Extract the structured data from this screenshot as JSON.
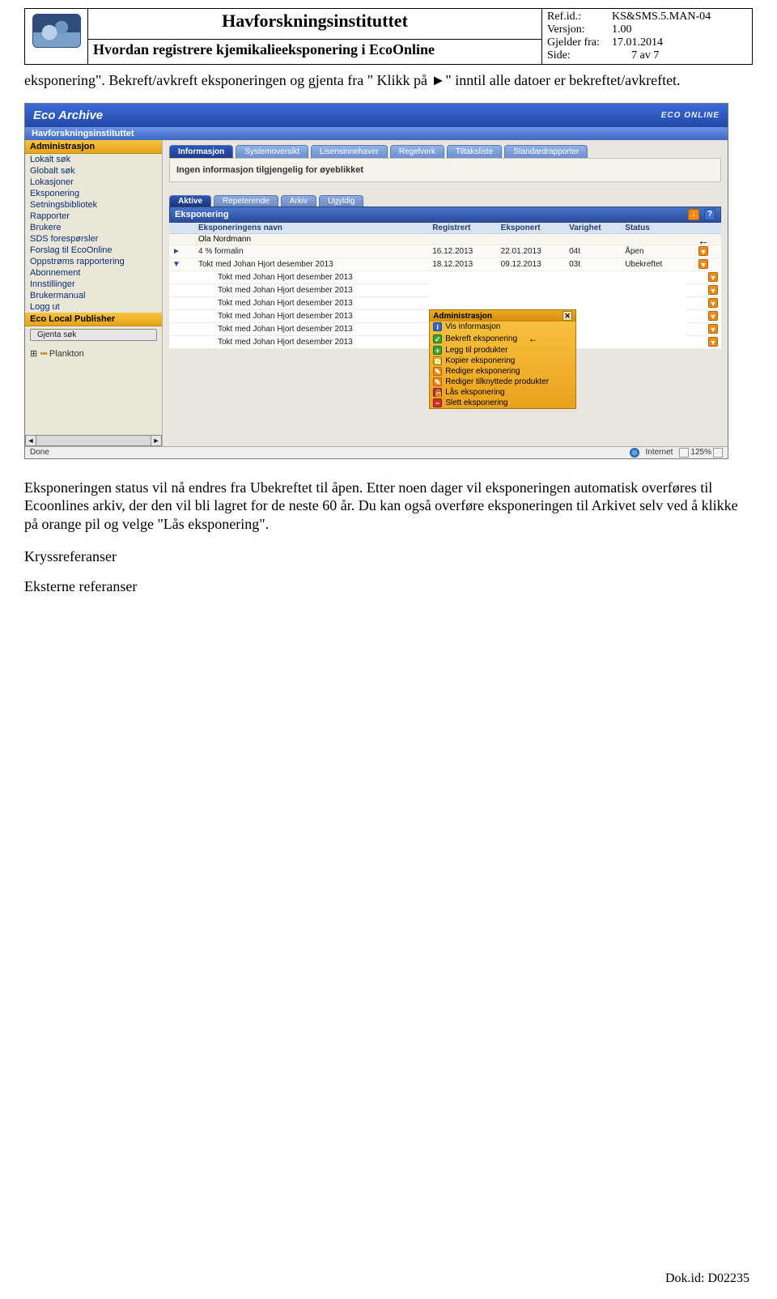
{
  "header": {
    "institution": "Havforskningsinstituttet",
    "subtitle": "Hvordan registrere kjemikalieeksponering i EcoOnline",
    "ref_label": "Ref.id.:",
    "ref_value": "KS&SMS.5.MAN-04",
    "ver_label": "Versjon:",
    "ver_value": "1.00",
    "from_label": "Gjelder fra:",
    "from_value": "17.01.2014",
    "side_label": "Side:",
    "side_value": "7 av 7"
  },
  "para1": "eksponering\". Bekreft/avkreft eksponeringen og gjenta fra \" Klikk på ►\" inntil alle datoer er bekreftet/avkreftet.",
  "para2": "Eksponeringen status vil nå endres fra Ubekreftet til åpen. Etter noen dager vil eksponeringen automatisk overføres til Ecoonlines arkiv, der den vil bli lagret for de neste 60 år. Du kan også overføre eksponeringen til Arkivet selv ved å klikke på orange pil og velge \"Lås eksponering\".",
  "h_kryss": "Kryssreferanser",
  "h_ext": "Eksterne referanser",
  "footer_id": "Dok.id: D02235",
  "eco": {
    "title": "Eco Archive",
    "brand": "ECO ONLINE",
    "identity": "Havforskningsinstituttet",
    "side_admin": "Administrasjon",
    "side_links": [
      "Lokalt søk",
      "Globalt søk",
      "Lokasjoner",
      "Eksponering",
      "Setningsbibliotek",
      "Rapporter",
      "Brukere",
      "SDS forespørsler",
      "Forslag til EcoOnline",
      "Oppstrøms rapportering",
      "Abonnement",
      "Innstillinger",
      "Brukermanual",
      "Logg ut"
    ],
    "side_pub": "Eco Local Publisher",
    "side_btn": "Gjenta søk",
    "side_tree": "Plankton",
    "tabs": [
      "Informasjon",
      "Systemoversikt",
      "Lisensinnehaver",
      "Regelverk",
      "Tiltaksliste",
      "Standardrapporter"
    ],
    "info_msg": "Ingen informasjon tilgjengelig for øyeblikket",
    "sub_tabs": [
      "Aktive",
      "Repeterende",
      "Arkiv",
      "Ugyldig"
    ],
    "eksp_title": "Eksponering",
    "cols": {
      "name": "Eksponeringens navn",
      "reg": "Registrert",
      "eksp": "Eksponert",
      "var": "Varighet",
      "stat": "Status"
    },
    "person": "Ola Nordmann",
    "rows": [
      {
        "toggle": "►",
        "name": "4 % formalin",
        "reg": "16.12.2013",
        "eksp": "22.01.2013",
        "var": "04t",
        "stat": "Åpen"
      },
      {
        "toggle": "▼",
        "name": "Tokt med Johan Hjort desember 2013",
        "reg": "18.12.2013",
        "eksp": "09.12.2013",
        "var": "03t",
        "stat": "Ubekreftet"
      }
    ],
    "child_name": "Tokt med Johan Hjort desember 2013",
    "ctx": {
      "title": "Administrasjon",
      "items": [
        {
          "icon": "blue",
          "glyph": "i",
          "label": "Vis informasjon"
        },
        {
          "icon": "green",
          "glyph": "✓",
          "label": "Bekreft eksponering",
          "arrow": true
        },
        {
          "icon": "green",
          "glyph": "+",
          "label": "Legg til produkter"
        },
        {
          "icon": "yellow",
          "glyph": "⧉",
          "label": "Kopier eksponering"
        },
        {
          "icon": "orange",
          "glyph": "✎",
          "label": "Rediger eksponering"
        },
        {
          "icon": "orange",
          "glyph": "✎",
          "label": "Rediger tilknyttede produkter"
        },
        {
          "icon": "red",
          "glyph": "🔒",
          "label": "Lås eksponering"
        },
        {
          "icon": "red",
          "glyph": "−",
          "label": "Slett eksponering"
        }
      ]
    },
    "status_done": "Done",
    "status_net": "Internet",
    "zoom": "125%"
  },
  "arrow_marker": "←"
}
